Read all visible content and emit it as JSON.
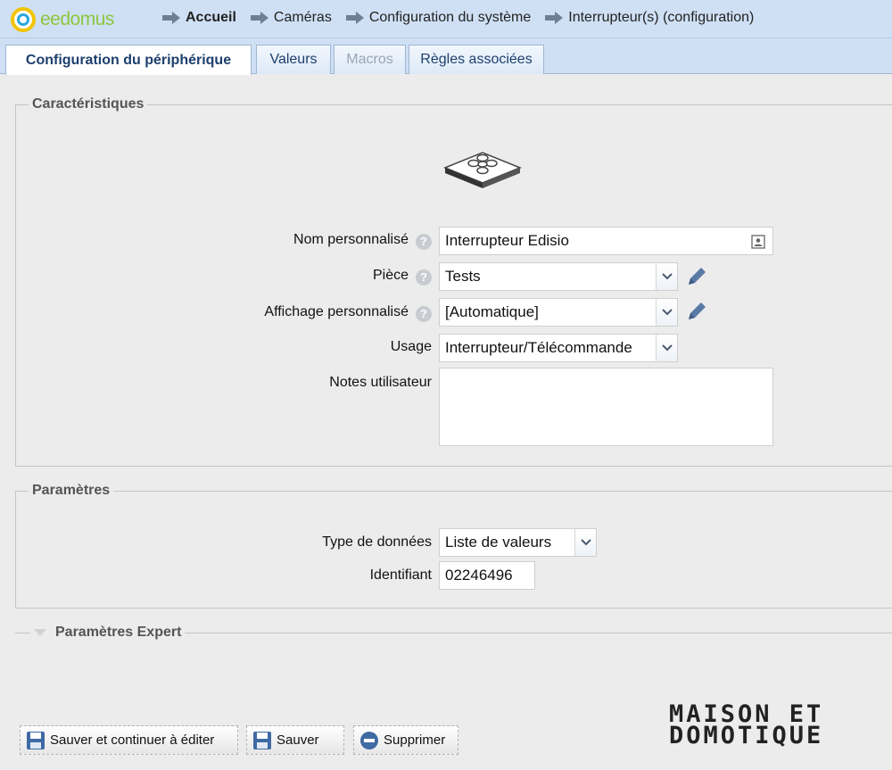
{
  "app": {
    "logo_text": "eedomus"
  },
  "breadcrumb": [
    {
      "label": "Accueil"
    },
    {
      "label": "Caméras"
    },
    {
      "label": "Configuration du système"
    },
    {
      "label": "Interrupteur(s) (configuration)"
    }
  ],
  "tabs": [
    {
      "label": "Configuration du périphérique",
      "state": "active"
    },
    {
      "label": "Valeurs",
      "state": "normal"
    },
    {
      "label": "Macros",
      "state": "disabled"
    },
    {
      "label": "Règles associées",
      "state": "normal"
    }
  ],
  "characteristics": {
    "legend": "Caractéristiques",
    "device_icon": "switch-remote-icon",
    "name_label": "Nom personnalisé",
    "name_value": "Interrupteur Edisio",
    "room_label": "Pièce",
    "room_value": "Tests",
    "display_label": "Affichage personnalisé",
    "display_value": "[Automatique]",
    "usage_label": "Usage",
    "usage_value": "Interrupteur/Télécommande",
    "notes_label": "Notes utilisateur",
    "notes_value": ""
  },
  "parameters": {
    "legend": "Paramètres",
    "data_type_label": "Type de données",
    "data_type_value": "Liste de valeurs",
    "id_label": "Identifiant",
    "id_value": "02246496"
  },
  "expert": {
    "legend": "Paramètres Expert"
  },
  "actions": {
    "save_continue": "Sauver et continuer à éditer",
    "save": "Sauver",
    "delete": "Supprimer"
  },
  "watermark": {
    "line1": "MAISON ET",
    "line2": "DOMOTIQUE"
  },
  "colors": {
    "header_bg": "#cfe0f4",
    "tab_text": "#1d3f6e",
    "page_bg": "#ececec",
    "logo_green": "#8cc63f"
  }
}
